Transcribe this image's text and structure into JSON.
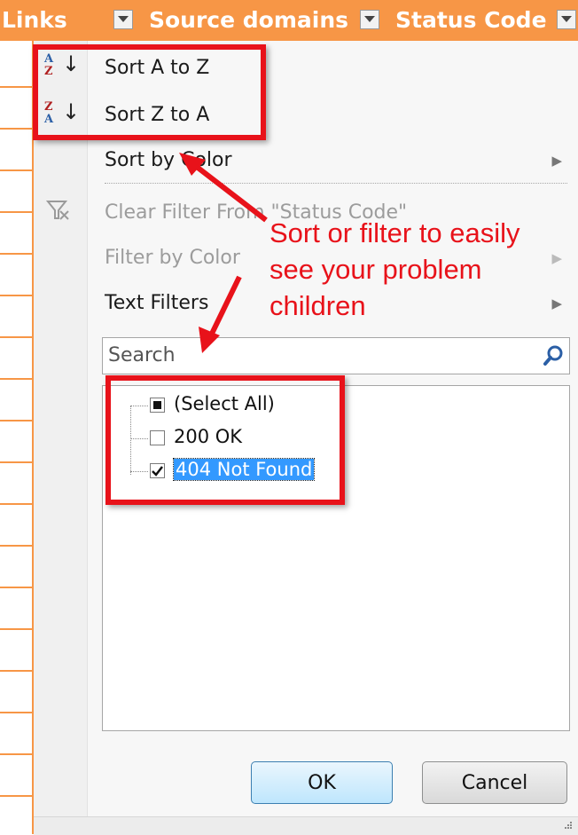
{
  "header": {
    "columns": [
      {
        "label": "Links"
      },
      {
        "label": "Source domains"
      },
      {
        "label": "Status Code"
      }
    ]
  },
  "menu": {
    "sort_az": "Sort A to Z",
    "sort_za": "Sort Z to A",
    "sort_by_color": "Sort by Color",
    "clear_filter": "Clear Filter From \"Status Code\"",
    "filter_by_color": "Filter by Color",
    "text_filters": "Text Filters"
  },
  "search": {
    "placeholder": "Search"
  },
  "filter_list": [
    {
      "label": "(Select All)",
      "state": "indeterminate"
    },
    {
      "label": "200 OK",
      "state": "unchecked"
    },
    {
      "label": "404 Not Found",
      "state": "checked"
    }
  ],
  "buttons": {
    "ok": "OK",
    "cancel": "Cancel"
  },
  "annotation": {
    "text": "Sort or filter to easily see your problem children"
  },
  "colors": {
    "header": "#f79646",
    "annotation_red": "#e8121a",
    "selection": "#3399ff"
  }
}
